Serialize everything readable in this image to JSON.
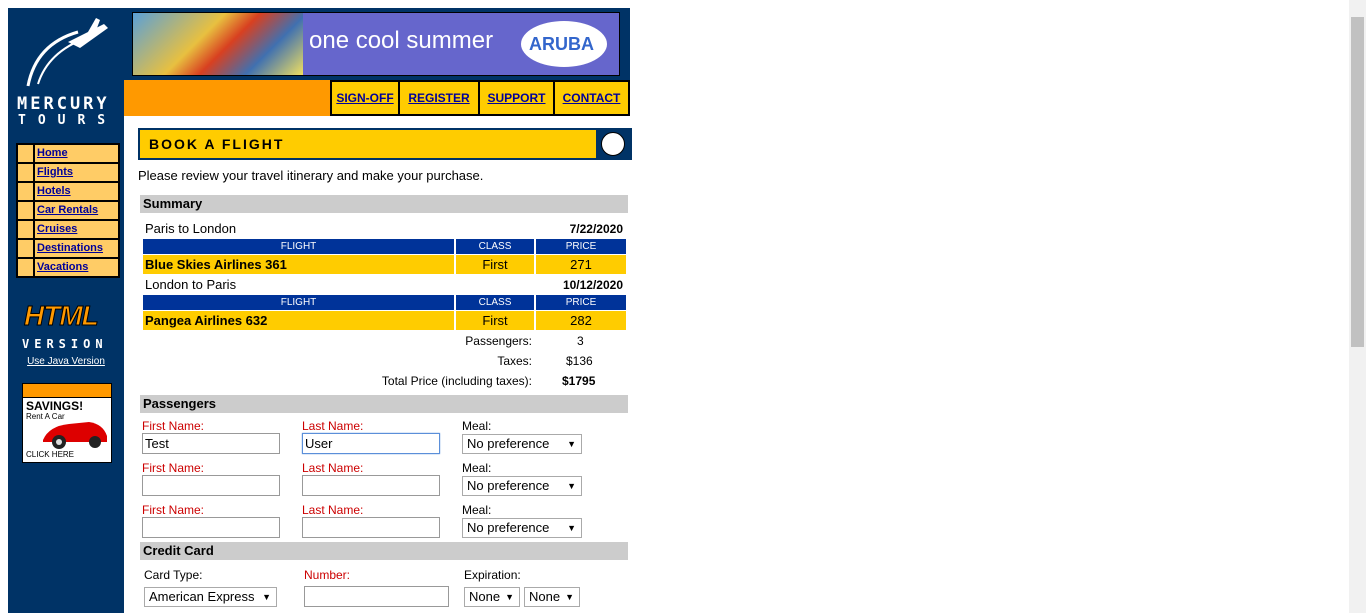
{
  "brand": {
    "word1": "MERCURY",
    "word2": "TOURS"
  },
  "sidebar": {
    "items": [
      {
        "label": "Home"
      },
      {
        "label": "Flights"
      },
      {
        "label": "Hotels"
      },
      {
        "label": "Car Rentals"
      },
      {
        "label": "Cruises"
      },
      {
        "label": "Destinations"
      },
      {
        "label": "Vacations"
      }
    ]
  },
  "html_badge": {
    "line1": "HTML",
    "line2": "VERSION",
    "link": "Use Java Version"
  },
  "ad": {
    "headline": "SAVINGS!",
    "sub": "Rent A Car",
    "cta": "CLICK HERE"
  },
  "banner": {
    "tagline": "one cool summer",
    "logo": "ARUBA"
  },
  "topnav": {
    "signoff": "SIGN-OFF",
    "register": "REGISTER",
    "support": "SUPPORT",
    "contact": "CONTACT"
  },
  "page": {
    "title": "BOOK A FLIGHT",
    "intro": "Please review your travel itinerary and make your purchase."
  },
  "summary": {
    "heading": "Summary",
    "columns": {
      "flight": "FLIGHT",
      "class": "CLASS",
      "price": "PRICE"
    },
    "depart": {
      "route": "Paris to London",
      "date": "7/22/2020",
      "flight": "Blue Skies Airlines 361",
      "class": "First",
      "price": "271"
    },
    "return": {
      "route": "London to Paris",
      "date": "10/12/2020",
      "flight": "Pangea Airlines 632",
      "class": "First",
      "price": "282"
    },
    "passengers_label": "Passengers:",
    "passengers": "3",
    "taxes_label": "Taxes:",
    "taxes": "$136",
    "total_label": "Total Price (including taxes):",
    "total": "$1795"
  },
  "passengers": {
    "heading": "Passengers",
    "first_label": "First Name:",
    "last_label": "Last Name:",
    "meal_label": "Meal:",
    "rows": [
      {
        "first": "Test",
        "last": "User",
        "meal": "No preference"
      },
      {
        "first": "",
        "last": "",
        "meal": "No preference"
      },
      {
        "first": "",
        "last": "",
        "meal": "No preference"
      }
    ]
  },
  "credit_card": {
    "heading": "Credit Card",
    "type_label": "Card Type:",
    "number_label": "Number:",
    "exp_label": "Expiration:",
    "type": "American Express",
    "number": "",
    "exp_month": "None",
    "exp_year": "None"
  },
  "colors": {
    "navy": "#003366",
    "orange": "#ff9900",
    "yellow": "#ffcc00",
    "link": "#000099",
    "required": "#cc0000"
  }
}
